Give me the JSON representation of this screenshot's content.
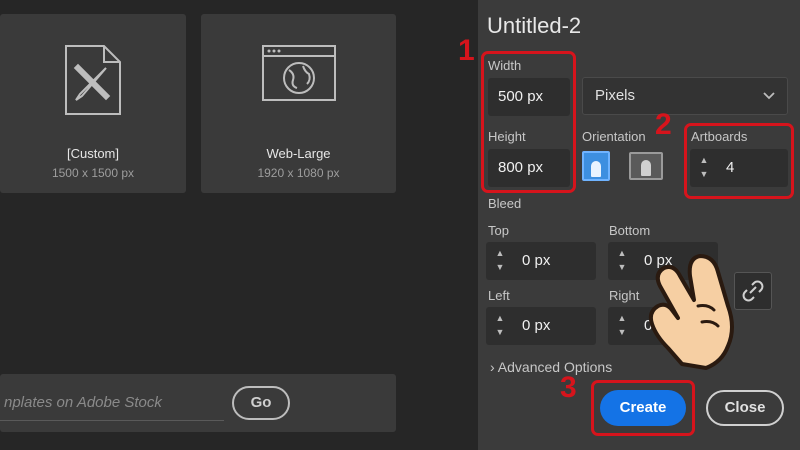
{
  "presets": [
    {
      "name": "[Custom]",
      "size": "1500 x 1500 px",
      "icon": "document-ruler-pencil-icon"
    },
    {
      "name": "Web-Large",
      "size": "1920 x 1080 px",
      "icon": "browser-globe-icon"
    }
  ],
  "search": {
    "placeholder": "nplates on Adobe Stock",
    "go_label": "Go"
  },
  "document": {
    "title": "Untitled-2",
    "width_label": "Width",
    "width_value": "500 px",
    "units_value": "Pixels",
    "height_label": "Height",
    "height_value": "800 px",
    "orientation_label": "Orientation",
    "artboards_label": "Artboards",
    "artboards_value": "4",
    "bleed_label": "Bleed",
    "bleed": {
      "top_label": "Top",
      "top_value": "0 px",
      "bottom_label": "Bottom",
      "bottom_value": "0 px",
      "left_label": "Left",
      "left_value": "0 px",
      "right_label": "Right",
      "right_value": "0 px"
    },
    "advanced_label": "Advanced Options",
    "create_label": "Create",
    "close_label": "Close"
  },
  "annotations": {
    "step1": "1",
    "step2": "2",
    "step3": "3"
  },
  "colors": {
    "accent": "#1473e6",
    "annotation": "#d6141c",
    "panel": "#3b3b3b"
  }
}
